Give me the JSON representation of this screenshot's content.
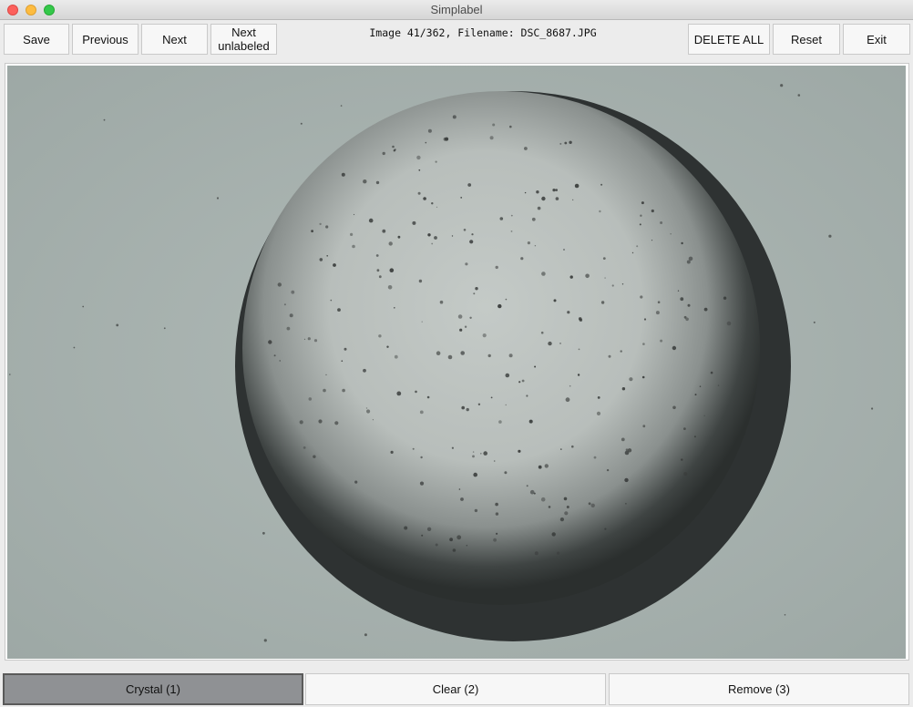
{
  "window": {
    "title": "Simplabel"
  },
  "toolbar": {
    "save_label": "Save",
    "previous_label": "Previous",
    "next_label": "Next",
    "next_unlabeled_line1": "Next",
    "next_unlabeled_line2": "unlabeled",
    "delete_all_label": "DELETE ALL",
    "reset_label": "Reset",
    "exit_label": "Exit"
  },
  "status": {
    "text": "Image 41/362, Filename: DSC_8687.JPG"
  },
  "labels": {
    "active": "crystal",
    "crystal_label": "Crystal (1)",
    "clear_label": "Clear (2)",
    "remove_label": "Remove (3)"
  },
  "colors": {
    "active_label_bg": "#8f9194",
    "image_background": "#a9b3b0"
  }
}
